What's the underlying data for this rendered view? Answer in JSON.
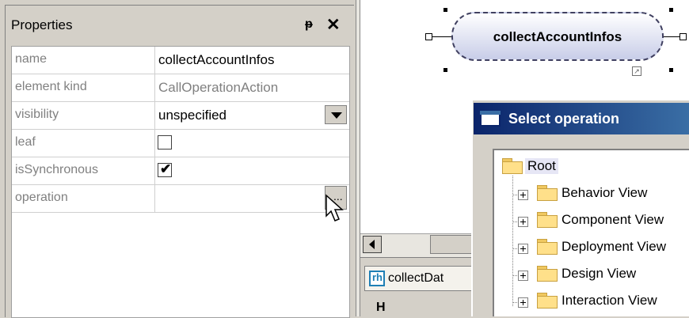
{
  "properties_panel": {
    "title": "Properties",
    "pin_glyph": "ᵽ",
    "close_glyph": "✕",
    "rows": [
      {
        "name": "name",
        "value": "collectAccountInfos"
      },
      {
        "name": "element kind",
        "value": "CallOperationAction"
      },
      {
        "name": "visibility",
        "value": "unspecified"
      },
      {
        "name": "leaf",
        "checked": false
      },
      {
        "name": "isSynchronous",
        "checked": true,
        "check_glyph": "✔"
      },
      {
        "name": "operation",
        "value": "",
        "button_label": "..."
      }
    ]
  },
  "diagram": {
    "action_label": "collectAccountInfos",
    "tab_label": "collectDat",
    "tab_icon_glyph": "rh",
    "tab_overflow": "H"
  },
  "dialog": {
    "title": "Select operation",
    "tree": {
      "root": "Root",
      "items": [
        {
          "label": "Behavior View"
        },
        {
          "label": "Component View"
        },
        {
          "label": "Deployment View"
        },
        {
          "label": "Design View"
        },
        {
          "label": "Interaction View"
        }
      ]
    }
  },
  "colors": {
    "panel_bg": "#d4d0c8",
    "dialog_title_bg": "#0a246a",
    "folder": "#ffe08a",
    "node_fill": "#c8cde8"
  }
}
